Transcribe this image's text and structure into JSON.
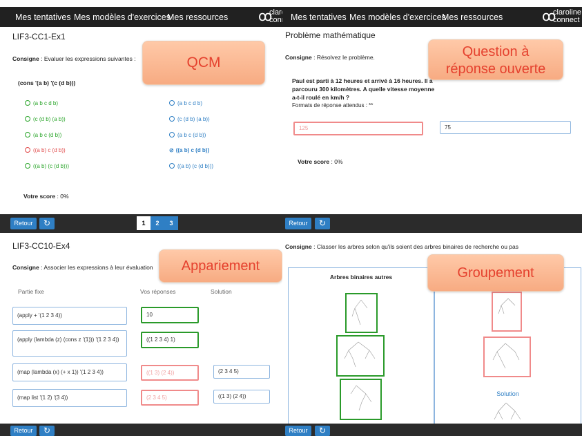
{
  "nav": {
    "items": [
      "Mes tentatives",
      "Mes modèles d'exercices",
      "Mes ressources"
    ],
    "logo_left": [
      "claro",
      "conne"
    ],
    "logo_right": [
      "claroline",
      "connect"
    ]
  },
  "colors": {
    "accent": "#2f7fc4",
    "nav_bg": "#212121",
    "correct": "#2aa52a",
    "wrong": "#e04848",
    "label_text": "#e5412e"
  },
  "q1": {
    "title": "LIF3-CC1-Ex1",
    "consigne_label": "Consigne",
    "consigne_text": " : Evaluer les expressions suivantes :",
    "expression": "(cons '(a b) '(c (d b)))",
    "left_options": [
      {
        "text": "(a b c d b)",
        "state": "green"
      },
      {
        "text": "(c (d b) (a b))",
        "state": "green"
      },
      {
        "text": "(a b c (d b))",
        "state": "green"
      },
      {
        "text": "((a b) c (d b))",
        "state": "red"
      },
      {
        "text": "((a b) (c (d b)))",
        "state": "green"
      }
    ],
    "right_options": [
      {
        "text": "(a b c d b)",
        "checked": false
      },
      {
        "text": "(c (d b) (a b))",
        "checked": false
      },
      {
        "text": "(a b c (d b))",
        "checked": false
      },
      {
        "text": "((a b) c (d b))",
        "checked": true
      },
      {
        "text": "((a b) (c (d b)))",
        "checked": false
      }
    ],
    "score_label": "Votre score",
    "score_value": " : 0%",
    "tag": "QCM",
    "retour": "Retour",
    "pages": [
      "1",
      "2",
      "3"
    ]
  },
  "q2": {
    "title": "Problème mathématique",
    "consigne_label": "Consigne",
    "consigne_text": " : Résolvez le problème.",
    "problem_lines": [
      "Paul est parti à 12 heures et arrivé à 16 heures. Il a",
      "parcouru 300 kilomètres. A quelle vitesse moyenne",
      "a-t-il roulé en km/h ?"
    ],
    "formats": "Formats de réponse attendus : **",
    "answer_user": "125",
    "answer_correct": "75",
    "score_label": "Votre score",
    "score_value": " : 0%",
    "tag_lines": [
      "Question à",
      "réponse ouverte"
    ],
    "retour": "Retour"
  },
  "q3": {
    "title": "LIF3-CC10-Ex4",
    "consigne_label": "Consigne",
    "consigne_text": " : Associer les expressions à leur évaluation",
    "col_fixed": "Partie fixe",
    "col_answer": "Vos réponses",
    "col_solution": "Solution",
    "rows": [
      {
        "fixed": "(apply + '(1 2 3 4))",
        "answer": "10",
        "state": "green",
        "solution": ""
      },
      {
        "fixed": "(apply (lambda (z) (cons z '(1))) '(1 2 3 4))",
        "answer": "((1 2 3 4) 1)",
        "state": "green",
        "solution": ""
      },
      {
        "fixed": "(map (lambda (x) (+ x 1)) '(1 2 3 4))",
        "answer": "((1 3) (2 4))",
        "state": "red",
        "solution": "(2 3 4 5)"
      },
      {
        "fixed": "(map list '(1 2) '(3 4))",
        "answer": "(2 3 4 5)",
        "state": "red",
        "solution": "((1 3) (2 4))"
      }
    ],
    "tag": "Appariement",
    "retour": "Retour"
  },
  "q4": {
    "consigne_label": "Consigne",
    "consigne_text": " : Classer les arbres selon qu'ils soient des arbres binaires de recherche ou pas",
    "panel_left_title": "Arbres binaires autres",
    "solution_label": "Solution",
    "tag": "Groupement",
    "retour": "Retour"
  }
}
